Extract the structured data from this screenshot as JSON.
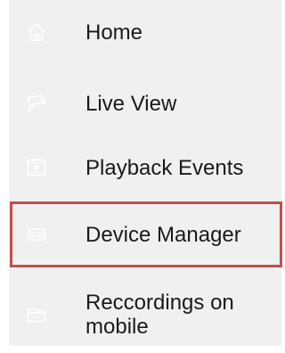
{
  "menu": {
    "items": [
      {
        "id": "home",
        "label": "Home",
        "icon": "home-icon"
      },
      {
        "id": "live",
        "label": "Live View",
        "icon": "camera-icon"
      },
      {
        "id": "playback",
        "label": "Playback Events",
        "icon": "video-playback-icon"
      },
      {
        "id": "device",
        "label": "Device Manager",
        "icon": "device-manager-icon",
        "highlighted": true
      },
      {
        "id": "recordings",
        "label": "Reccordings on mobile",
        "icon": "folder-icon"
      }
    ]
  },
  "colors": {
    "menu_background": "#f0f0f0",
    "icon_color": "#ffffff",
    "text_color": "#1a1a1a",
    "highlight_border": "#c0504d"
  }
}
